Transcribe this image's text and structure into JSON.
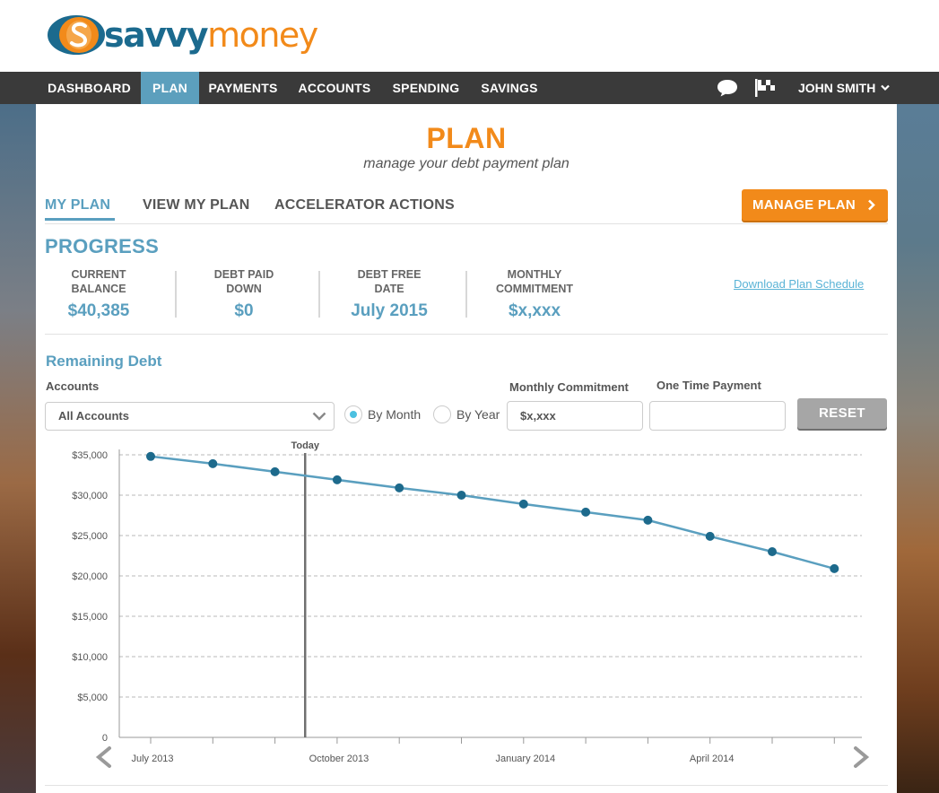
{
  "brand": {
    "name_part1": "savvy",
    "name_part2": "money"
  },
  "nav": {
    "items": [
      {
        "label": "DASHBOARD",
        "active": false
      },
      {
        "label": "PLAN",
        "active": true
      },
      {
        "label": "PAYMENTS",
        "active": false
      },
      {
        "label": "ACCOUNTS",
        "active": false
      },
      {
        "label": "SPENDING",
        "active": false
      },
      {
        "label": "SAVINGS",
        "active": false
      }
    ],
    "user": "JOHN SMITH",
    "icons": [
      "chat-bubble-icon",
      "flag-icon",
      "chevron-down-icon"
    ]
  },
  "page": {
    "title": "PLAN",
    "subtitle": "manage your debt payment plan"
  },
  "tabs": [
    {
      "label": "MY PLAN",
      "active": true
    },
    {
      "label": "VIEW MY PLAN",
      "active": false
    },
    {
      "label": "ACCELERATOR ACTIONS",
      "active": false
    }
  ],
  "manage_button": {
    "label": "MANAGE PLAN",
    "icon": "chevron-right-icon"
  },
  "progress": {
    "heading": "PROGRESS",
    "stats": [
      {
        "label_line1": "CURRENT",
        "label_line2": "BALANCE",
        "value": "$40,385"
      },
      {
        "label_line1": "DEBT PAID",
        "label_line2": "DOWN",
        "value": "$0"
      },
      {
        "label_line1": "DEBT FREE",
        "label_line2": "DATE",
        "value": "July 2015"
      },
      {
        "label_line1": "MONTHLY",
        "label_line2": "COMMITMENT",
        "value": "$x,xxx"
      }
    ],
    "download_link": "Download Plan Schedule"
  },
  "remaining": {
    "title": "Remaining Debt",
    "accounts_label": "Accounts",
    "accounts_value": "All Accounts",
    "by_month_label": "By Month",
    "by_year_label": "By Year",
    "by_month_selected": true,
    "monthly_commitment_label": "Monthly Commitment",
    "monthly_commitment_value": "$x,xxx",
    "one_time_payment_label": "One Time Payment",
    "one_time_payment_value": "",
    "reset_label": "RESET"
  },
  "colors": {
    "accent_orange": "#f28a1a",
    "accent_blue": "#5a9fbf",
    "nav_bg": "#3a3a3a",
    "line": "#5a9fbf",
    "point": "#1d6a8c"
  },
  "chart_data": {
    "type": "line",
    "title": "",
    "xlabel": "",
    "ylabel": "",
    "ylim": [
      0,
      35000
    ],
    "y_ticks": [
      "$35,000",
      "$30,000",
      "$25,000",
      "$20,000",
      "$15,000",
      "$10,000",
      "$5,000",
      "0"
    ],
    "y_tick_values": [
      35000,
      30000,
      25000,
      20000,
      15000,
      10000,
      5000,
      0
    ],
    "x": [
      "2013-07",
      "2013-08",
      "2013-09",
      "2013-10",
      "2013-11",
      "2013-12",
      "2014-01",
      "2014-02",
      "2014-03",
      "2014-04",
      "2014-05",
      "2014-06"
    ],
    "x_tick_labels": [
      {
        "label": "July 2013",
        "x": "2013-07"
      },
      {
        "label": "October 2013",
        "x": "2013-10"
      },
      {
        "label": "January 2014",
        "x": "2014-01"
      },
      {
        "label": "April 2014",
        "x": "2014-04"
      }
    ],
    "series": [
      {
        "values": [
          34800,
          33900,
          32900,
          31900,
          30900,
          30000,
          28900,
          27900,
          26900,
          24900,
          23000,
          20900
        ]
      }
    ],
    "marker": {
      "label": "Today"
    },
    "grid": "horizontal dashed"
  }
}
